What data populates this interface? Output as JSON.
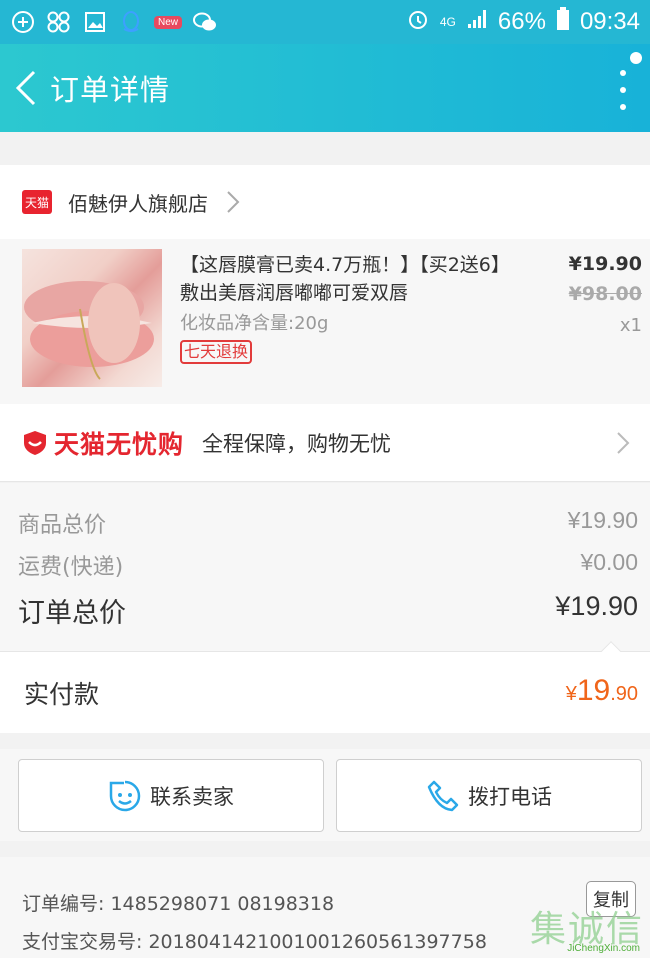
{
  "status_bar": {
    "new_badge": "New",
    "network": "4G",
    "battery": "66%",
    "time": "09:34"
  },
  "header": {
    "title": "订单详情"
  },
  "shop": {
    "badge": "天猫",
    "name": "佰魅伊人旗舰店"
  },
  "product": {
    "title": "【这唇膜膏已卖4.7万瓶！】【买2送6】敷出美唇润唇嘟嘟可爱双唇",
    "spec": "化妆品净含量:20g",
    "return_badge": "七天退换",
    "price": "¥19.90",
    "original_price": "¥98.00",
    "quantity": "x1"
  },
  "worry_free": {
    "brand": "天猫无忧购",
    "description": "全程保障，购物无忧"
  },
  "summary": {
    "goods_total_label": "商品总价",
    "goods_total_value": "¥19.90",
    "shipping_label": "运费(快递)",
    "shipping_value": "¥0.00",
    "order_total_label": "订单总价",
    "order_total_value": "¥19.90"
  },
  "payment": {
    "label": "实付款",
    "currency": "¥",
    "integer": "19",
    "decimal": ".90"
  },
  "actions": {
    "contact_seller": "联系卖家",
    "call_phone": "拨打电话"
  },
  "order_info": {
    "order_number": "订单编号: 1485298071 08198318",
    "alipay_number": "支付宝交易号: 2018041421001001260561397758",
    "copy_label": "复制"
  },
  "watermark": {
    "text": "集诚信",
    "url": "JiChengXin.com"
  },
  "colors": {
    "header_start": "#2cc8d0",
    "header_end": "#18b2d8",
    "tmall_red": "#e4262f",
    "pay_orange": "#f0651a"
  }
}
